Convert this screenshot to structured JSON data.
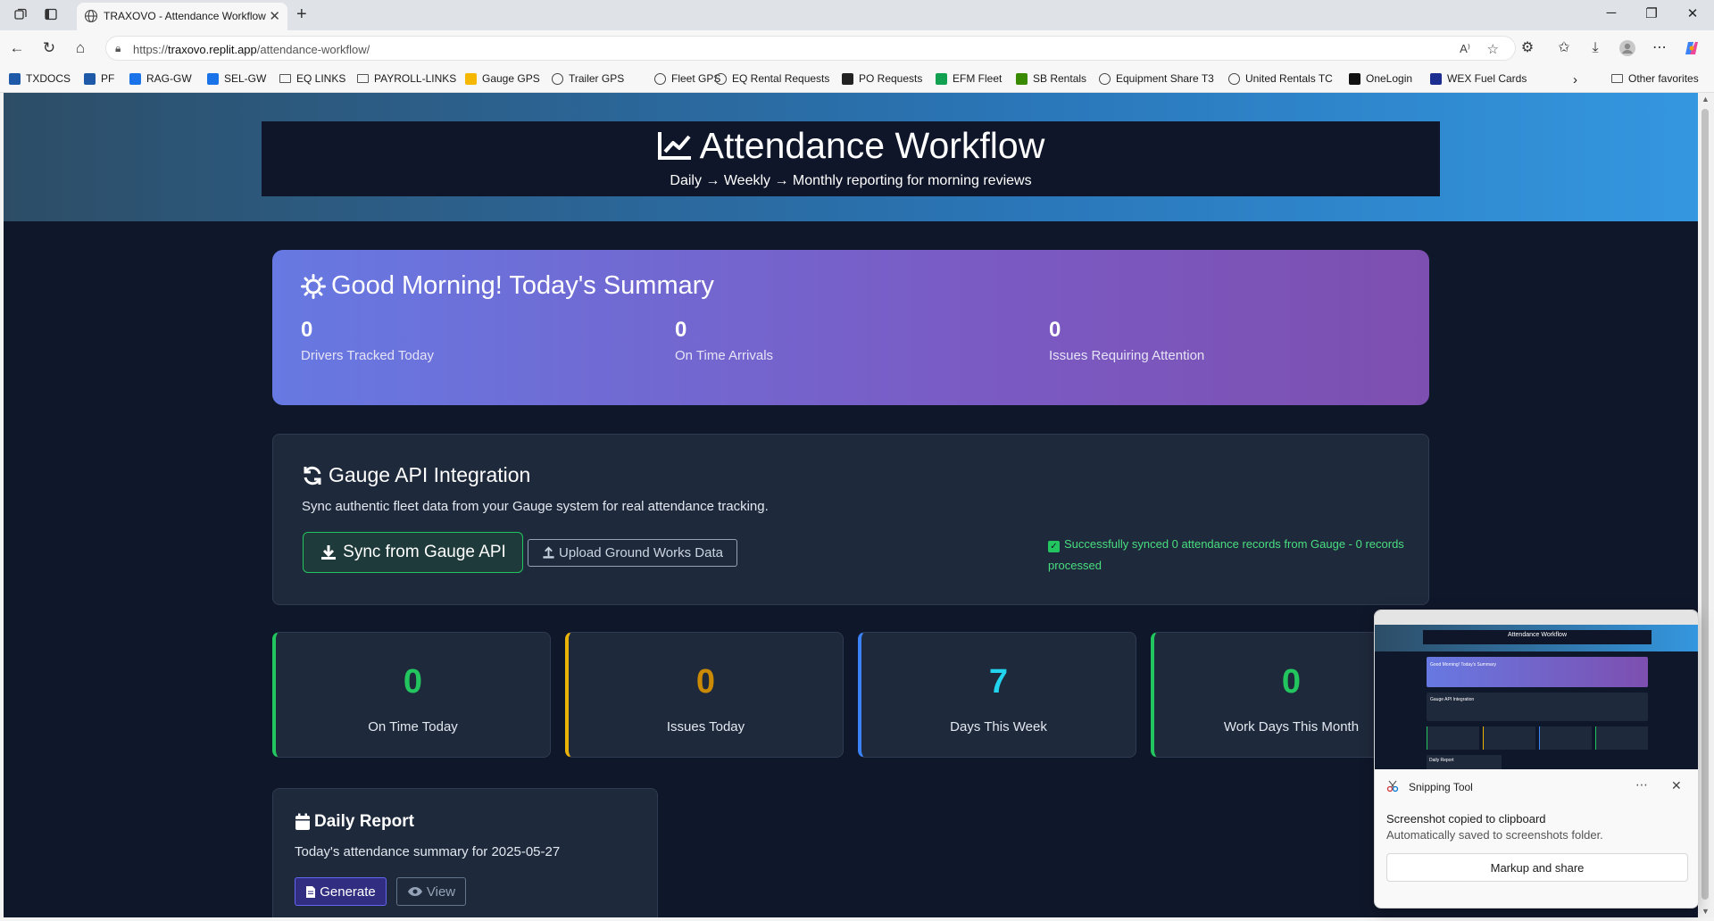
{
  "browser": {
    "tab_title": "TRAXOVO - Attendance Workflow",
    "url_prefix": "https://",
    "url_host": "traxovo.replit.app",
    "url_path": "/attendance-workflow/"
  },
  "favorites": [
    {
      "label": "TXDOCS",
      "color": "#1e5aa8"
    },
    {
      "label": "PF",
      "color": "#1e5aa8"
    },
    {
      "label": "RAG-GW",
      "color": "#1a73e8"
    },
    {
      "label": "SEL-GW",
      "color": "#1a73e8"
    },
    {
      "label": "EQ LINKS",
      "color": "folder"
    },
    {
      "label": "PAYROLL-LINKS",
      "color": "folder"
    },
    {
      "label": "Gauge GPS",
      "color": "#f5b700"
    },
    {
      "label": "Trailer GPS",
      "color": "globe"
    },
    {
      "label": "Fleet GPS",
      "color": "globe"
    },
    {
      "label": "EQ Rental Requests",
      "color": "globe"
    },
    {
      "label": "PO Requests",
      "color": "#222"
    },
    {
      "label": "EFM Fleet",
      "color": "#12a150"
    },
    {
      "label": "SB Rentals",
      "color": "#3a8a00"
    },
    {
      "label": "Equipment Share T3",
      "color": "globe"
    },
    {
      "label": "United Rentals TC",
      "color": "globe"
    },
    {
      "label": "OneLogin",
      "color": "#111"
    },
    {
      "label": "WEX Fuel Cards",
      "color": "#1c2e8f"
    }
  ],
  "other_favorites": "Other favorites",
  "header": {
    "title": "Attendance Workflow",
    "subtitle": "Daily → Weekly → Monthly reporting for morning reviews"
  },
  "summary": {
    "title": "Good Morning! Today's Summary",
    "stats": [
      {
        "value": "0",
        "label": "Drivers Tracked Today"
      },
      {
        "value": "0",
        "label": "On Time Arrivals"
      },
      {
        "value": "0",
        "label": "Issues Requiring Attention"
      }
    ]
  },
  "gauge": {
    "title": "Gauge API Integration",
    "description": "Sync authentic fleet data from your Gauge system for real attendance tracking.",
    "sync_label": "Sync from Gauge API",
    "upload_label": "Upload Ground Works Data",
    "status": "Successfully synced 0 attendance records from Gauge - 0 records processed"
  },
  "stats": [
    {
      "value": "0",
      "label": "On Time Today",
      "color": "#22c55e"
    },
    {
      "value": "0",
      "label": "Issues Today",
      "color": "#ca8a04"
    },
    {
      "value": "7",
      "label": "Days This Week",
      "color": "#22d3ee"
    },
    {
      "value": "0",
      "label": "Work Days This Month",
      "color": "#22c55e"
    }
  ],
  "daily_report": {
    "title": "Daily Report",
    "description": "Today's attendance summary for 2025-05-27",
    "generate_label": "Generate",
    "view_label": "View"
  },
  "snipping": {
    "app_name": "Snipping Tool",
    "heading": "Screenshot copied to clipboard",
    "subtext": "Automatically saved to screenshots folder.",
    "button": "Markup and share",
    "thumb_title": "Attendance Workflow",
    "thumb_summary": "Good Morning! Today's Summary",
    "thumb_api": "Gauge API Integration",
    "thumb_daily": "Daily Report"
  }
}
